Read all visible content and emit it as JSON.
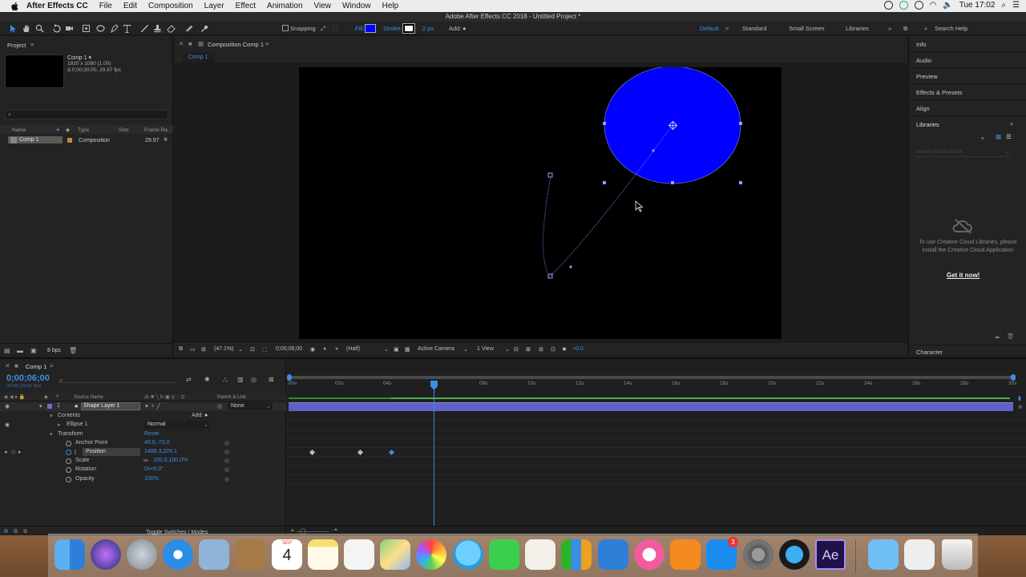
{
  "menubar": {
    "app": "After Effects CC",
    "items": [
      "File",
      "Edit",
      "Composition",
      "Layer",
      "Effect",
      "Animation",
      "View",
      "Window",
      "Help"
    ],
    "clock": "Tue 17:02"
  },
  "window_title": "Adobe After Effects CC 2018 - Untitled Project *",
  "toolbar": {
    "snapping": "Snapping",
    "fill_label": "Fill:",
    "fill_color": "#0000ff",
    "stroke_label": "Stroke:",
    "stroke_width": "2 px",
    "add_label": "Add:",
    "workspaces": [
      "Default",
      "Standard",
      "Small Screen",
      "Libraries"
    ],
    "search_help": "Search Help"
  },
  "project": {
    "tab": "Project",
    "comp_name": "Comp 1 ▾",
    "comp_info1": "1920 x 1080 (1.00)",
    "comp_info2": "Δ 0;00;30;00, 29.97 fps",
    "columns": {
      "name": "Name",
      "type": "Type",
      "size": "Size",
      "frame_rate": "Frame Ra..."
    },
    "items": [
      {
        "name": "Comp 1",
        "type": "Composition",
        "frame_rate": "29.97"
      }
    ],
    "bpc": "8 bpc"
  },
  "composition": {
    "tab": "Composition Comp 1",
    "sub_tab": "Comp 1",
    "zoom": "(47.1%)",
    "timecode": "0;00;06;00",
    "resolution": "(Half)",
    "camera": "Active Camera",
    "views": "1 View",
    "exposure": "+0.0"
  },
  "right_panels": {
    "items": [
      "Info",
      "Audio",
      "Preview",
      "Effects & Presets",
      "Align",
      "Libraries"
    ],
    "search_stock": "Search Adobe Stock",
    "cc_message": "To use Creative Cloud Libraries, please install the Creative Cloud Application",
    "get_it": "Get it now!",
    "character": "Character"
  },
  "timeline": {
    "tab": "Comp 1",
    "timecode": "0;00;06;00",
    "frames": "00180 (29.97 fps)",
    "col_source": "Source Name",
    "col_parent": "Parent & Link",
    "layer_num": "1",
    "layer_name": "Shape Layer 1",
    "parent": "None",
    "contents": "Contents",
    "add": "Add:",
    "ellipse": "Ellipse 1",
    "blend_mode": "Normal",
    "transform": "Transform",
    "reset": "Reset",
    "properties": [
      {
        "name": "Anchor Point",
        "value": "49.0,-73.0"
      },
      {
        "name": "Position",
        "value": "1488.3,228.1"
      },
      {
        "name": "Scale",
        "value": "100.0,100.0%"
      },
      {
        "name": "Rotation",
        "value": "0x+0.0°"
      },
      {
        "name": "Opacity",
        "value": "100%"
      }
    ],
    "ruler": [
      ":00s",
      "02s",
      "04s",
      "08s",
      "10s",
      "12s",
      "14s",
      "16s",
      "18s",
      "20s",
      "22s",
      "24s",
      "26s",
      "28s",
      "30s"
    ],
    "toggle": "Toggle Switches / Modes"
  },
  "dock": {
    "calendar_month": "SEP",
    "calendar_day": "4",
    "appstore_badge": "3",
    "ae_label": "Ae"
  }
}
